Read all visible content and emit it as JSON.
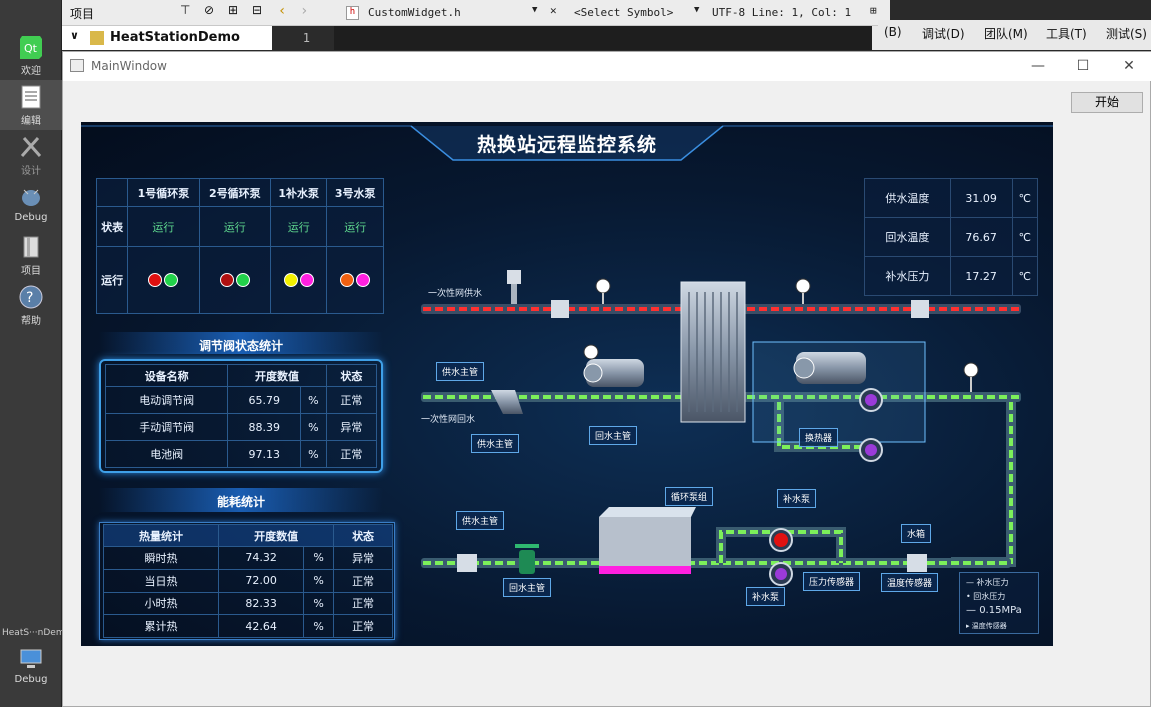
{
  "creator": {
    "project_header": "项目",
    "project_root": "HeatStationDemo",
    "editor_file": "CustomWidget.h",
    "symbol_select": "<Select Symbol>",
    "encoding_pos": "UTF-8 Line: 1, Col: 1",
    "line_number": "1",
    "menu": [
      "(B)",
      "调试(D)",
      "团队(M)",
      "工具(T)",
      "测试(S)"
    ],
    "modes": [
      "欢迎",
      "编辑",
      "设计",
      "Debug",
      "项目",
      "帮助"
    ],
    "target_name": "HeatS···nDemo",
    "target_mode": "Debug"
  },
  "window": {
    "title": "MainWindow",
    "start_label": "开始"
  },
  "dashboard": {
    "title": "热换站远程监控系统",
    "pumps": {
      "headers": [
        "1号循环泵",
        "2号循环泵",
        "1补水泵",
        "3号水泵"
      ],
      "status_label": "状表",
      "status": [
        "运行",
        "运行",
        "运行",
        "运行"
      ],
      "run_label": "运行",
      "lights": [
        [
          "#e01010",
          "#22d24a"
        ],
        [
          "#b01010",
          "#22d24a"
        ],
        [
          "#f2f000",
          "#ff20e0"
        ],
        [
          "#f06010",
          "#ff20e0"
        ]
      ]
    },
    "valves": {
      "title": "调节阀状态统计",
      "headers": [
        "设备名称",
        "开度数值",
        "状态"
      ],
      "rows": [
        {
          "name": "电动调节阀",
          "value": "65.79",
          "unit": "%",
          "state": "正常"
        },
        {
          "name": "手动调节阀",
          "value": "88.39",
          "unit": "%",
          "state": "异常"
        },
        {
          "name": "电池阀",
          "value": "97.13",
          "unit": "%",
          "state": "正常"
        }
      ]
    },
    "energy": {
      "title": "能耗统计",
      "headers": [
        "热量统计",
        "开度数值",
        "状态"
      ],
      "rows": [
        {
          "name": "瞬时热",
          "value": "74.32",
          "unit": "%",
          "state": "异常"
        },
        {
          "name": "当日热",
          "value": "72.00",
          "unit": "%",
          "state": "正常"
        },
        {
          "name": "小时热",
          "value": "82.33",
          "unit": "%",
          "state": "正常"
        },
        {
          "name": "累计热",
          "value": "42.64",
          "unit": "%",
          "state": "正常"
        }
      ]
    },
    "readings": [
      {
        "label": "供水温度",
        "value": "31.09",
        "unit": "℃"
      },
      {
        "label": "回水温度",
        "value": "76.67",
        "unit": "℃"
      },
      {
        "label": "补水压力",
        "value": "17.27",
        "unit": "℃"
      }
    ],
    "diagram": {
      "primary_supply": "一次性网供水",
      "primary_return": "一次性网回水",
      "supply_main_1": "供水主管",
      "return_main_1": "回水主管",
      "supply_main_2": "供水主管",
      "exchanger": "换热器",
      "circ_pump_group": "循环泵组",
      "makeup_pump_top": "补水泵",
      "makeup_pump_bottom": "补水泵",
      "supply_main_3": "供水主管",
      "return_main_2": "回水主管",
      "pressure_sensor": "压力传感器",
      "water_tank": "水箱",
      "temp_sensor": "温度传感器"
    },
    "legend": {
      "item1": "补水压力",
      "item2": "回水压力",
      "pressure": "0.15MPa",
      "item4": "温度传感器"
    }
  }
}
